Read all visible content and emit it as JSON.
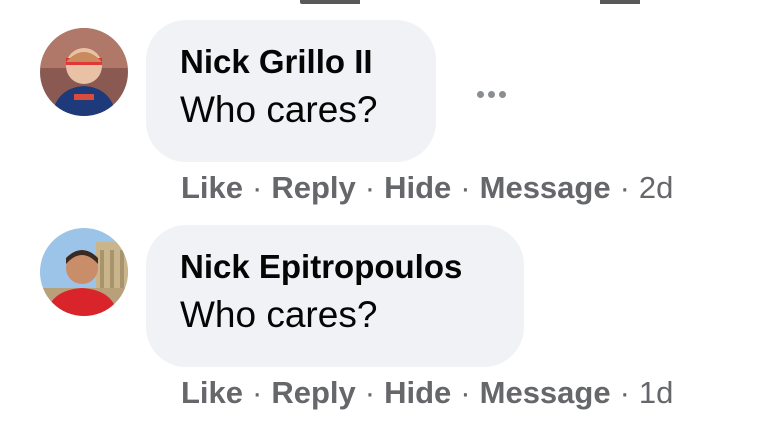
{
  "comments": [
    {
      "author": "Nick Grillo II",
      "text": "Who cares?",
      "actions": {
        "like": "Like",
        "reply": "Reply",
        "hide": "Hide",
        "message": "Message"
      },
      "separator": "·",
      "timestamp": "2d",
      "more_icon": "more-horizontal-icon"
    },
    {
      "author": "Nick Epitropoulos",
      "text": "Who cares?",
      "actions": {
        "like": "Like",
        "reply": "Reply",
        "hide": "Hide",
        "message": "Message"
      },
      "separator": "·",
      "timestamp": "1d"
    }
  ],
  "colors": {
    "bubble_bg": "#f0f2f5",
    "name_text": "#050505",
    "action_text": "#65676b"
  }
}
